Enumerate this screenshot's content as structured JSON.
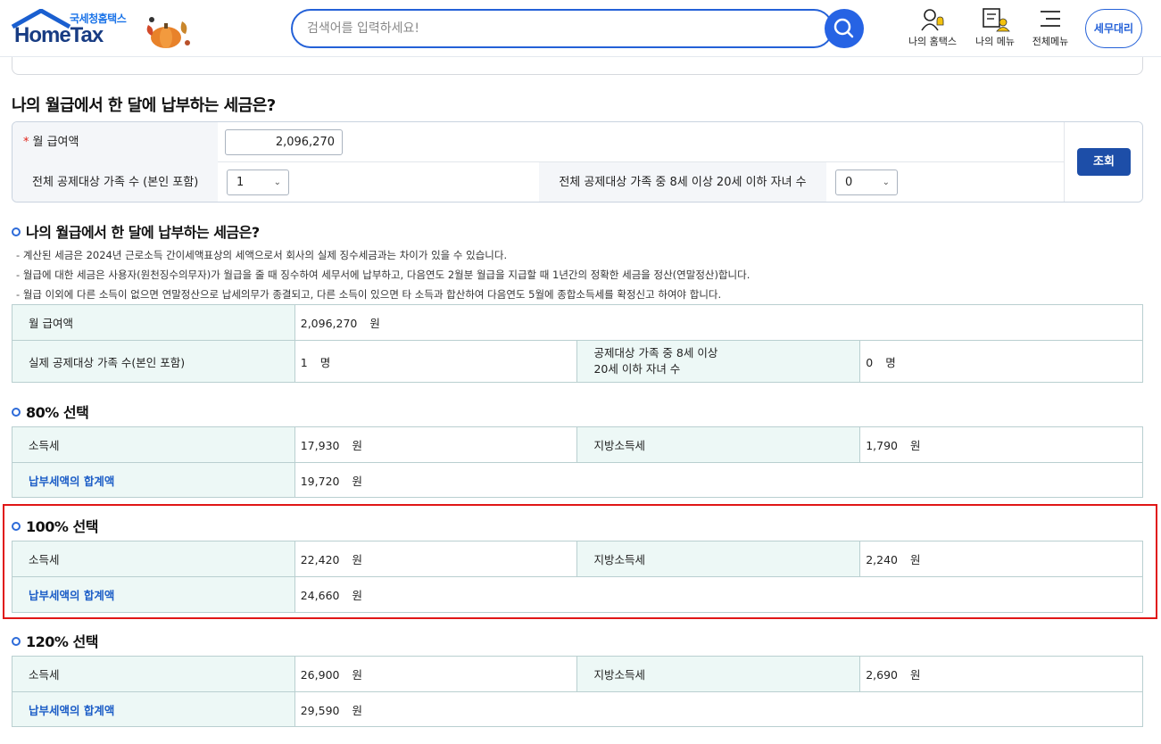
{
  "header": {
    "logo_sub": "국세청홈택스",
    "logo_main": "HomeTax",
    "search_placeholder": "검색어를 입력하세요!",
    "my_hometax": "나의 홈택스",
    "my_menu": "나의 메뉴",
    "all_menu": "전체메뉴",
    "tax_agent": "세무대리"
  },
  "page_title": "나의 월급에서 한 달에 납부하는 세금은?",
  "form": {
    "salary_label": "월 급여액",
    "salary_value": "2,096,270",
    "family_label": "전체 공제대상 가족 수 (본인 포함)",
    "family_value": "1",
    "children_label": "전체 공제대상 가족 중 8세 이상 20세 이하 자녀 수",
    "children_value": "0",
    "query_button": "조회"
  },
  "result": {
    "title": "나의 월급에서 한 달에 납부하는 세금은?",
    "notes": [
      "계산된 세금은  2024년  근로소득 간이세액표상의 세액으로서 회사의 실제 징수세금과는 차이가 있을 수 있습니다.",
      "월급에 대한 세금은 사용자(원천징수의무자)가 월급을 줄 때 징수하여 세무서에 납부하고, 다음연도 2월분 월급을 지급할 때 1년간의 정확한 세금을 정산(연말정산)합니다.",
      "월급 이외에 다른 소득이 없으면 연말정산으로 납세의무가 종결되고, 다른 소득이 있으면 타 소득과 합산하여 다음연도 5월에 종합소득세를 확정신고 하여야 합니다."
    ],
    "salary_label": "월 급여액",
    "salary_value": "2,096,270",
    "salary_unit": "원",
    "family_label": "실제 공제대상 가족 수(본인 포함)",
    "family_value": "1",
    "family_unit": "명",
    "children_label_1": "공제대상 가족 중 8세 이상",
    "children_label_2": "20세 이하 자녀 수",
    "children_value": "0",
    "children_unit": "명"
  },
  "options": [
    {
      "title": "80% 선택",
      "income_tax_label": "소득세",
      "income_tax": "17,930",
      "local_tax_label": "지방소득세",
      "local_tax": "1,790",
      "total_label": "납부세액의 합계액",
      "total": "19,720",
      "unit": "원"
    },
    {
      "title": "100% 선택",
      "income_tax_label": "소득세",
      "income_tax": "22,420",
      "local_tax_label": "지방소득세",
      "local_tax": "2,240",
      "total_label": "납부세액의 합계액",
      "total": "24,660",
      "unit": "원"
    },
    {
      "title": "120% 선택",
      "income_tax_label": "소득세",
      "income_tax": "26,900",
      "local_tax_label": "지방소득세",
      "local_tax": "2,690",
      "total_label": "납부세액의 합계액",
      "total": "29,590",
      "unit": "원"
    }
  ],
  "colors": {
    "brand": "#183c83",
    "accent": "#2663e4",
    "highlight": "#e01616",
    "label_bg": "#edf8f6"
  }
}
